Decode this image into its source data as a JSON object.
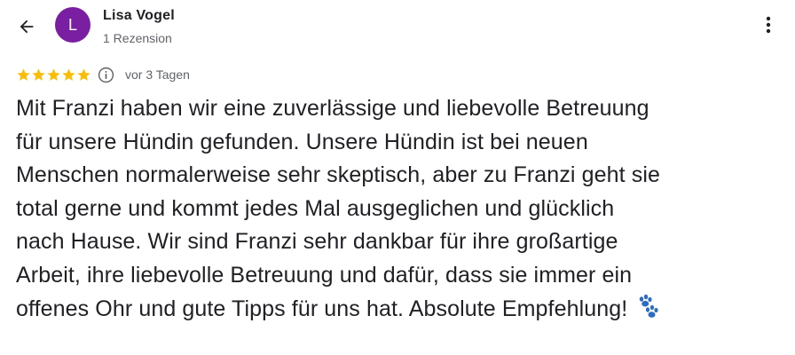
{
  "header": {
    "reviewer_name": "Lisa Vogel",
    "avatar_initial": "L",
    "avatar_color": "#7B1FA2",
    "review_count": "1 Rezension",
    "back_icon": "arrow-back-icon",
    "more_icon": "more-vert-icon"
  },
  "rating": {
    "stars": 5,
    "max_stars": 5,
    "star_color": "#FBBC04",
    "info_icon": "info-icon",
    "date": "vor 3 Tagen"
  },
  "review": {
    "lines": [
      "Mit Franzi haben wir eine zuverlässige und liebevolle Betreuung",
      "für unsere Hündin gefunden. Unsere Hündin ist bei neuen",
      "Menschen normalerweise sehr skeptisch, aber zu Franzi geht sie",
      "total gerne und kommt jedes Mal ausgeglichen und glücklich",
      "nach Hause. Wir sind Franzi sehr dankbar für ihre großartige",
      "Arbeit, ihre liebevolle Betreuung und dafür, dass sie immer ein",
      "offenes Ohr und gute Tipps für uns hat. Absolute Empfehlung!"
    ],
    "emoji_icon": "paw-prints-icon",
    "emoji_color": "#2C6DC4"
  }
}
